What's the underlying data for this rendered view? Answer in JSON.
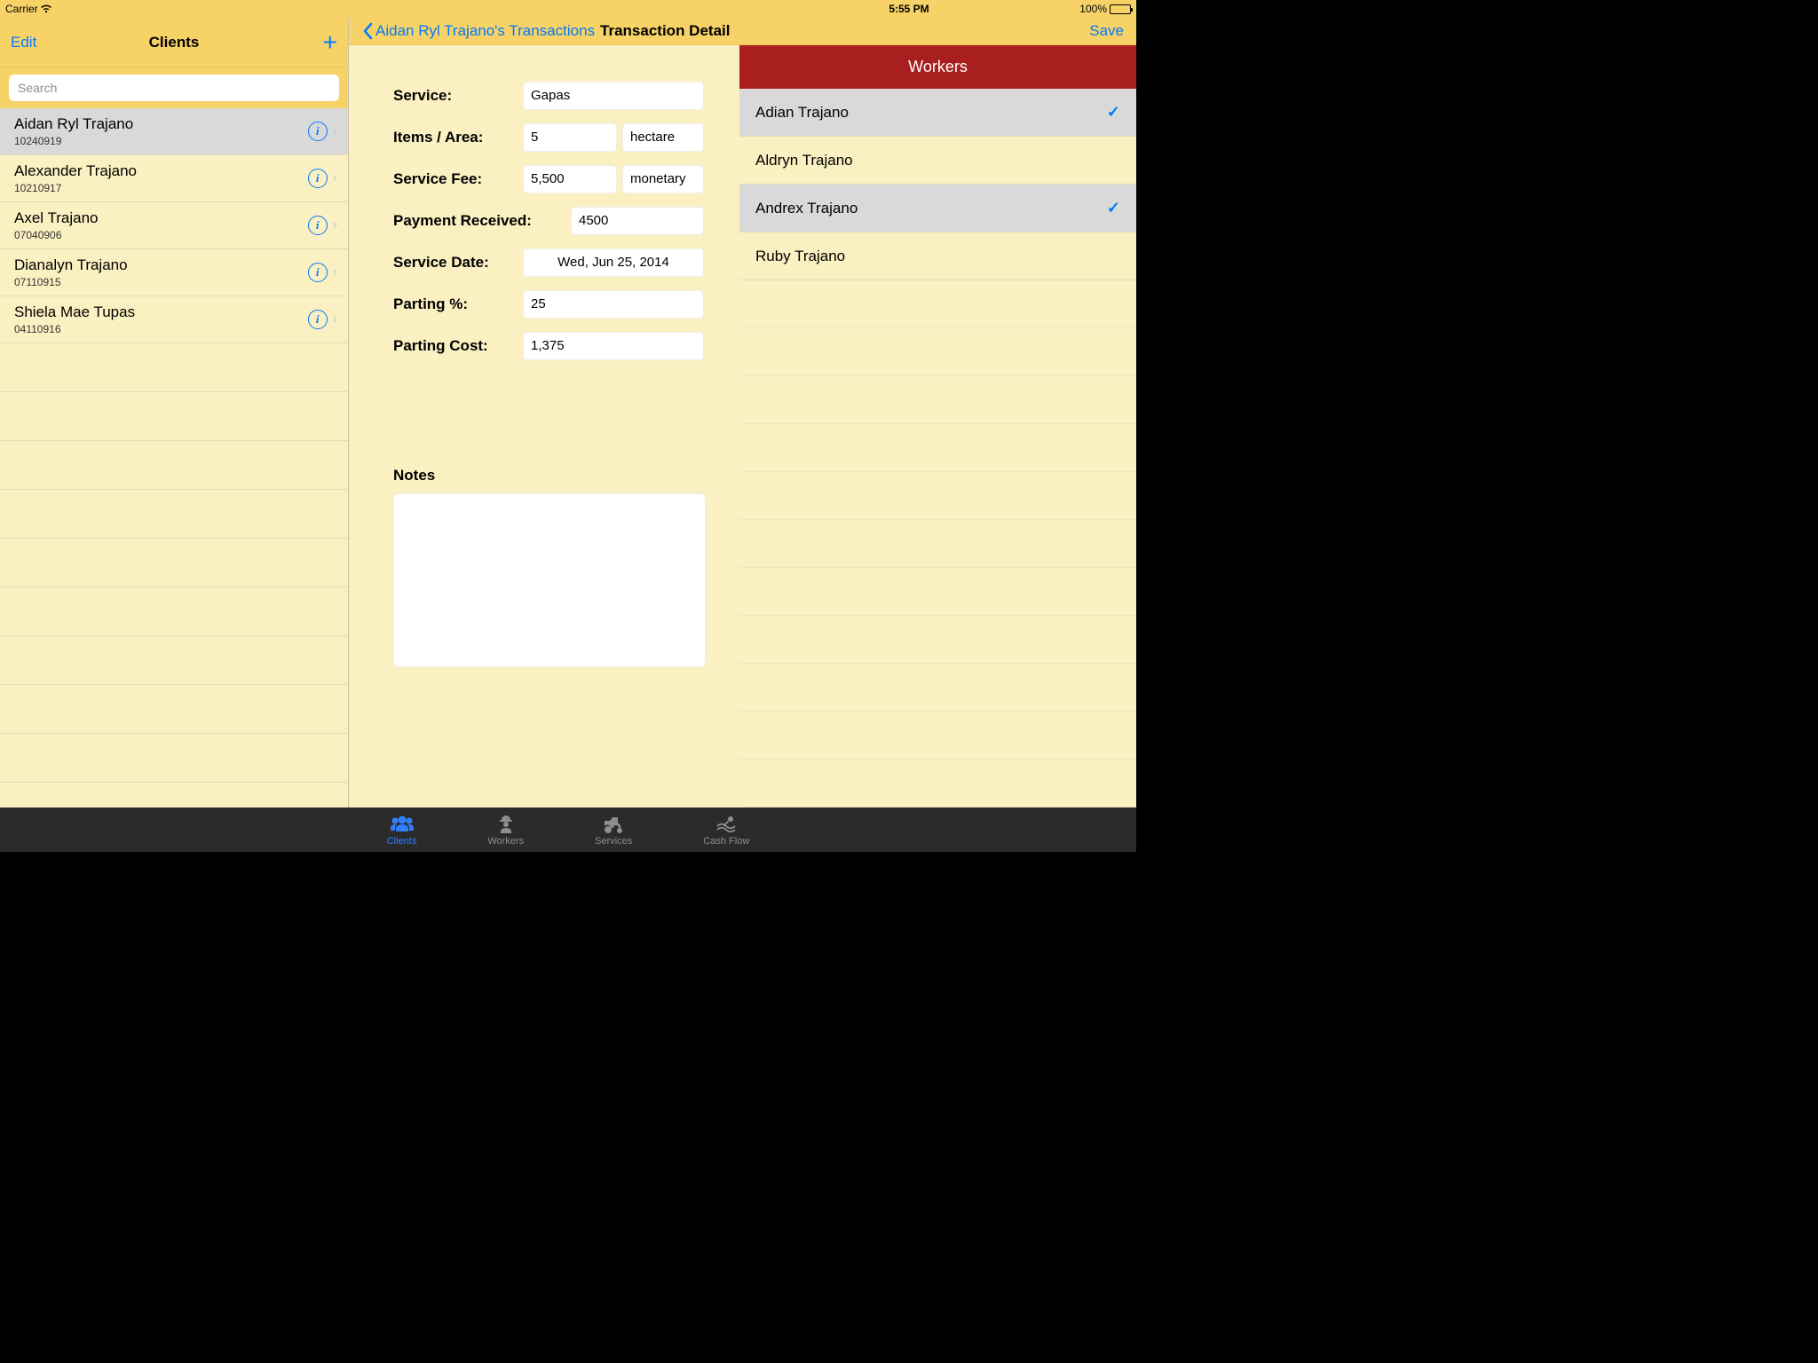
{
  "status": {
    "carrier": "Carrier",
    "time": "5:55 PM",
    "battery": "100%"
  },
  "sidebar": {
    "edit": "Edit",
    "title": "Clients",
    "search_placeholder": "Search",
    "clients": [
      {
        "name": "Aidan Ryl Trajano",
        "id": "10240919",
        "selected": true
      },
      {
        "name": "Alexander Trajano",
        "id": "10210917",
        "selected": false
      },
      {
        "name": "Axel Trajano",
        "id": "07040906",
        "selected": false
      },
      {
        "name": "Dianalyn Trajano",
        "id": "07110915",
        "selected": false
      },
      {
        "name": "Shiela Mae Tupas",
        "id": "04110916",
        "selected": false
      }
    ]
  },
  "detail": {
    "back": "Aidan Ryl Trajano's Transactions",
    "title": "Transaction Detail",
    "save": "Save",
    "labels": {
      "service": "Service:",
      "items": "Items / Area:",
      "fee": "Service Fee:",
      "payment": "Payment Received:",
      "date": "Service Date:",
      "parting_pct": "Parting %:",
      "parting_cost": "Parting Cost:",
      "notes": "Notes"
    },
    "values": {
      "service": "Gapas",
      "items": "5",
      "items_unit": "hectare",
      "fee": "5,500",
      "fee_unit": "monetary",
      "payment": "4500",
      "date": "Wed, Jun 25, 2014",
      "parting_pct": "25",
      "parting_cost": "1,375",
      "notes": ""
    }
  },
  "workers": {
    "header": "Workers",
    "list": [
      {
        "name": "Adian Trajano",
        "checked": true
      },
      {
        "name": "Aldryn Trajano",
        "checked": false
      },
      {
        "name": "Andrex Trajano",
        "checked": true
      },
      {
        "name": "Ruby Trajano",
        "checked": false
      }
    ]
  },
  "tabs": [
    {
      "label": "Clients",
      "active": true
    },
    {
      "label": "Workers",
      "active": false
    },
    {
      "label": "Services",
      "active": false
    },
    {
      "label": "Cash Flow",
      "active": false
    }
  ]
}
